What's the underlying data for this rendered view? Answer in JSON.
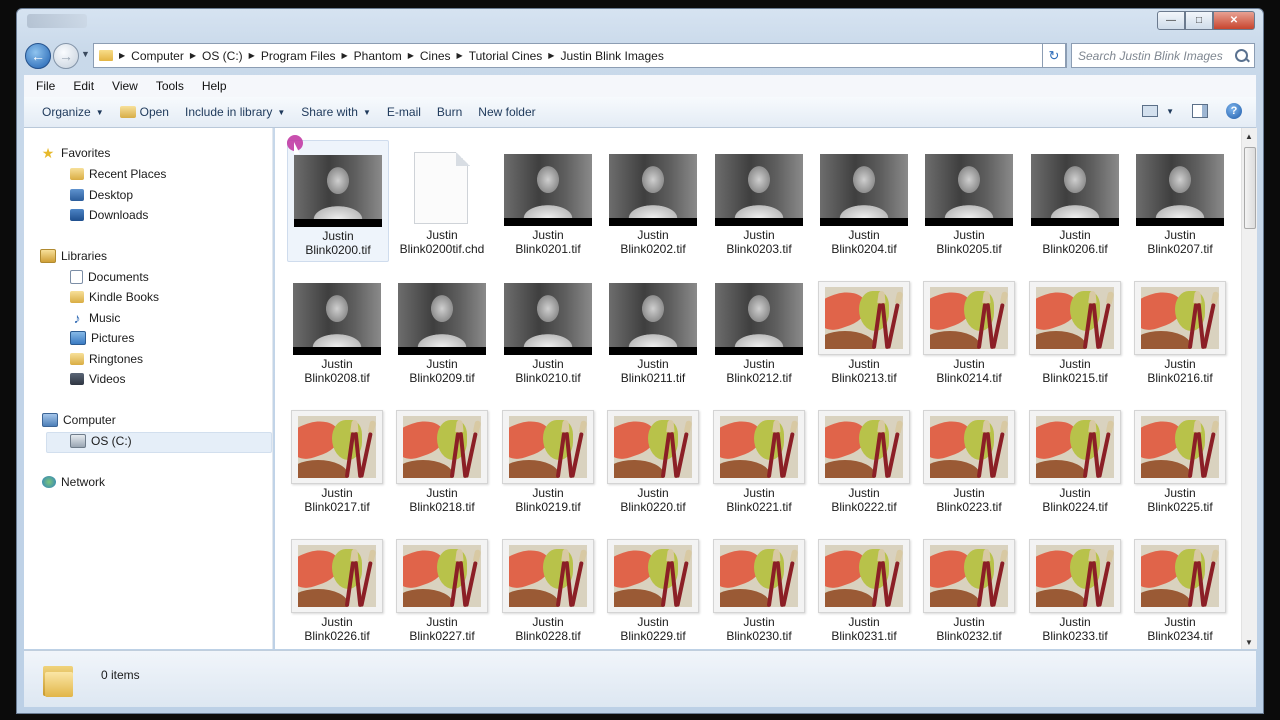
{
  "window": {
    "title": ""
  },
  "address": {
    "crumbs": [
      "Computer",
      "OS (C:)",
      "Program Files",
      "Phantom",
      "Cines",
      "Tutorial Cines",
      "Justin Blink Images"
    ]
  },
  "search": {
    "placeholder": "Search Justin Blink Images"
  },
  "menu": [
    "File",
    "Edit",
    "View",
    "Tools",
    "Help"
  ],
  "toolbar": {
    "organize": "Organize",
    "open": "Open",
    "include": "Include in library",
    "share": "Share with",
    "email": "E-mail",
    "burn": "Burn",
    "new_folder": "New folder"
  },
  "nav": {
    "favorites": "Favorites",
    "recent": "Recent Places",
    "desktop": "Desktop",
    "downloads": "Downloads",
    "libraries": "Libraries",
    "documents": "Documents",
    "kindle": "Kindle Books",
    "music": "Music",
    "pictures": "Pictures",
    "ringtones": "Ringtones",
    "videos": "Videos",
    "computer": "Computer",
    "osc": "OS (C:)",
    "network": "Network"
  },
  "files": [
    {
      "line1": "Justin",
      "line2": "Blink0200.tif",
      "kind": "photo",
      "selected": true
    },
    {
      "line1": "Justin",
      "line2": "Blink0200tif.chd",
      "kind": "blank"
    },
    {
      "line1": "Justin",
      "line2": "Blink0201.tif",
      "kind": "photo"
    },
    {
      "line1": "Justin",
      "line2": "Blink0202.tif",
      "kind": "photo"
    },
    {
      "line1": "Justin",
      "line2": "Blink0203.tif",
      "kind": "photo"
    },
    {
      "line1": "Justin",
      "line2": "Blink0204.tif",
      "kind": "photo"
    },
    {
      "line1": "Justin",
      "line2": "Blink0205.tif",
      "kind": "photo"
    },
    {
      "line1": "Justin",
      "line2": "Blink0206.tif",
      "kind": "photo"
    },
    {
      "line1": "Justin",
      "line2": "Blink0207.tif",
      "kind": "photo"
    },
    {
      "line1": "Justin",
      "line2": "Blink0208.tif",
      "kind": "photo"
    },
    {
      "line1": "Justin",
      "line2": "Blink0209.tif",
      "kind": "photo"
    },
    {
      "line1": "Justin",
      "line2": "Blink0210.tif",
      "kind": "photo"
    },
    {
      "line1": "Justin",
      "line2": "Blink0211.tif",
      "kind": "photo"
    },
    {
      "line1": "Justin",
      "line2": "Blink0212.tif",
      "kind": "photo"
    },
    {
      "line1": "Justin",
      "line2": "Blink0213.tif",
      "kind": "art"
    },
    {
      "line1": "Justin",
      "line2": "Blink0214.tif",
      "kind": "art"
    },
    {
      "line1": "Justin",
      "line2": "Blink0215.tif",
      "kind": "art"
    },
    {
      "line1": "Justin",
      "line2": "Blink0216.tif",
      "kind": "art"
    },
    {
      "line1": "Justin",
      "line2": "Blink0217.tif",
      "kind": "art"
    },
    {
      "line1": "Justin",
      "line2": "Blink0218.tif",
      "kind": "art"
    },
    {
      "line1": "Justin",
      "line2": "Blink0219.tif",
      "kind": "art"
    },
    {
      "line1": "Justin",
      "line2": "Blink0220.tif",
      "kind": "art"
    },
    {
      "line1": "Justin",
      "line2": "Blink0221.tif",
      "kind": "art"
    },
    {
      "line1": "Justin",
      "line2": "Blink0222.tif",
      "kind": "art"
    },
    {
      "line1": "Justin",
      "line2": "Blink0223.tif",
      "kind": "art"
    },
    {
      "line1": "Justin",
      "line2": "Blink0224.tif",
      "kind": "art"
    },
    {
      "line1": "Justin",
      "line2": "Blink0225.tif",
      "kind": "art"
    },
    {
      "line1": "Justin",
      "line2": "Blink0226.tif",
      "kind": "art"
    },
    {
      "line1": "Justin",
      "line2": "Blink0227.tif",
      "kind": "art"
    },
    {
      "line1": "Justin",
      "line2": "Blink0228.tif",
      "kind": "art"
    },
    {
      "line1": "Justin",
      "line2": "Blink0229.tif",
      "kind": "art"
    },
    {
      "line1": "Justin",
      "line2": "Blink0230.tif",
      "kind": "art"
    },
    {
      "line1": "Justin",
      "line2": "Blink0231.tif",
      "kind": "art"
    },
    {
      "line1": "Justin",
      "line2": "Blink0232.tif",
      "kind": "art"
    },
    {
      "line1": "Justin",
      "line2": "Blink0233.tif",
      "kind": "art"
    },
    {
      "line1": "Justin",
      "line2": "Blink0234.tif",
      "kind": "art"
    }
  ],
  "status": {
    "items": "0 items"
  },
  "colors": {
    "accent": "#1e5fb0",
    "selection": "#eef4fb",
    "window_frame": "#bcd0e6"
  }
}
